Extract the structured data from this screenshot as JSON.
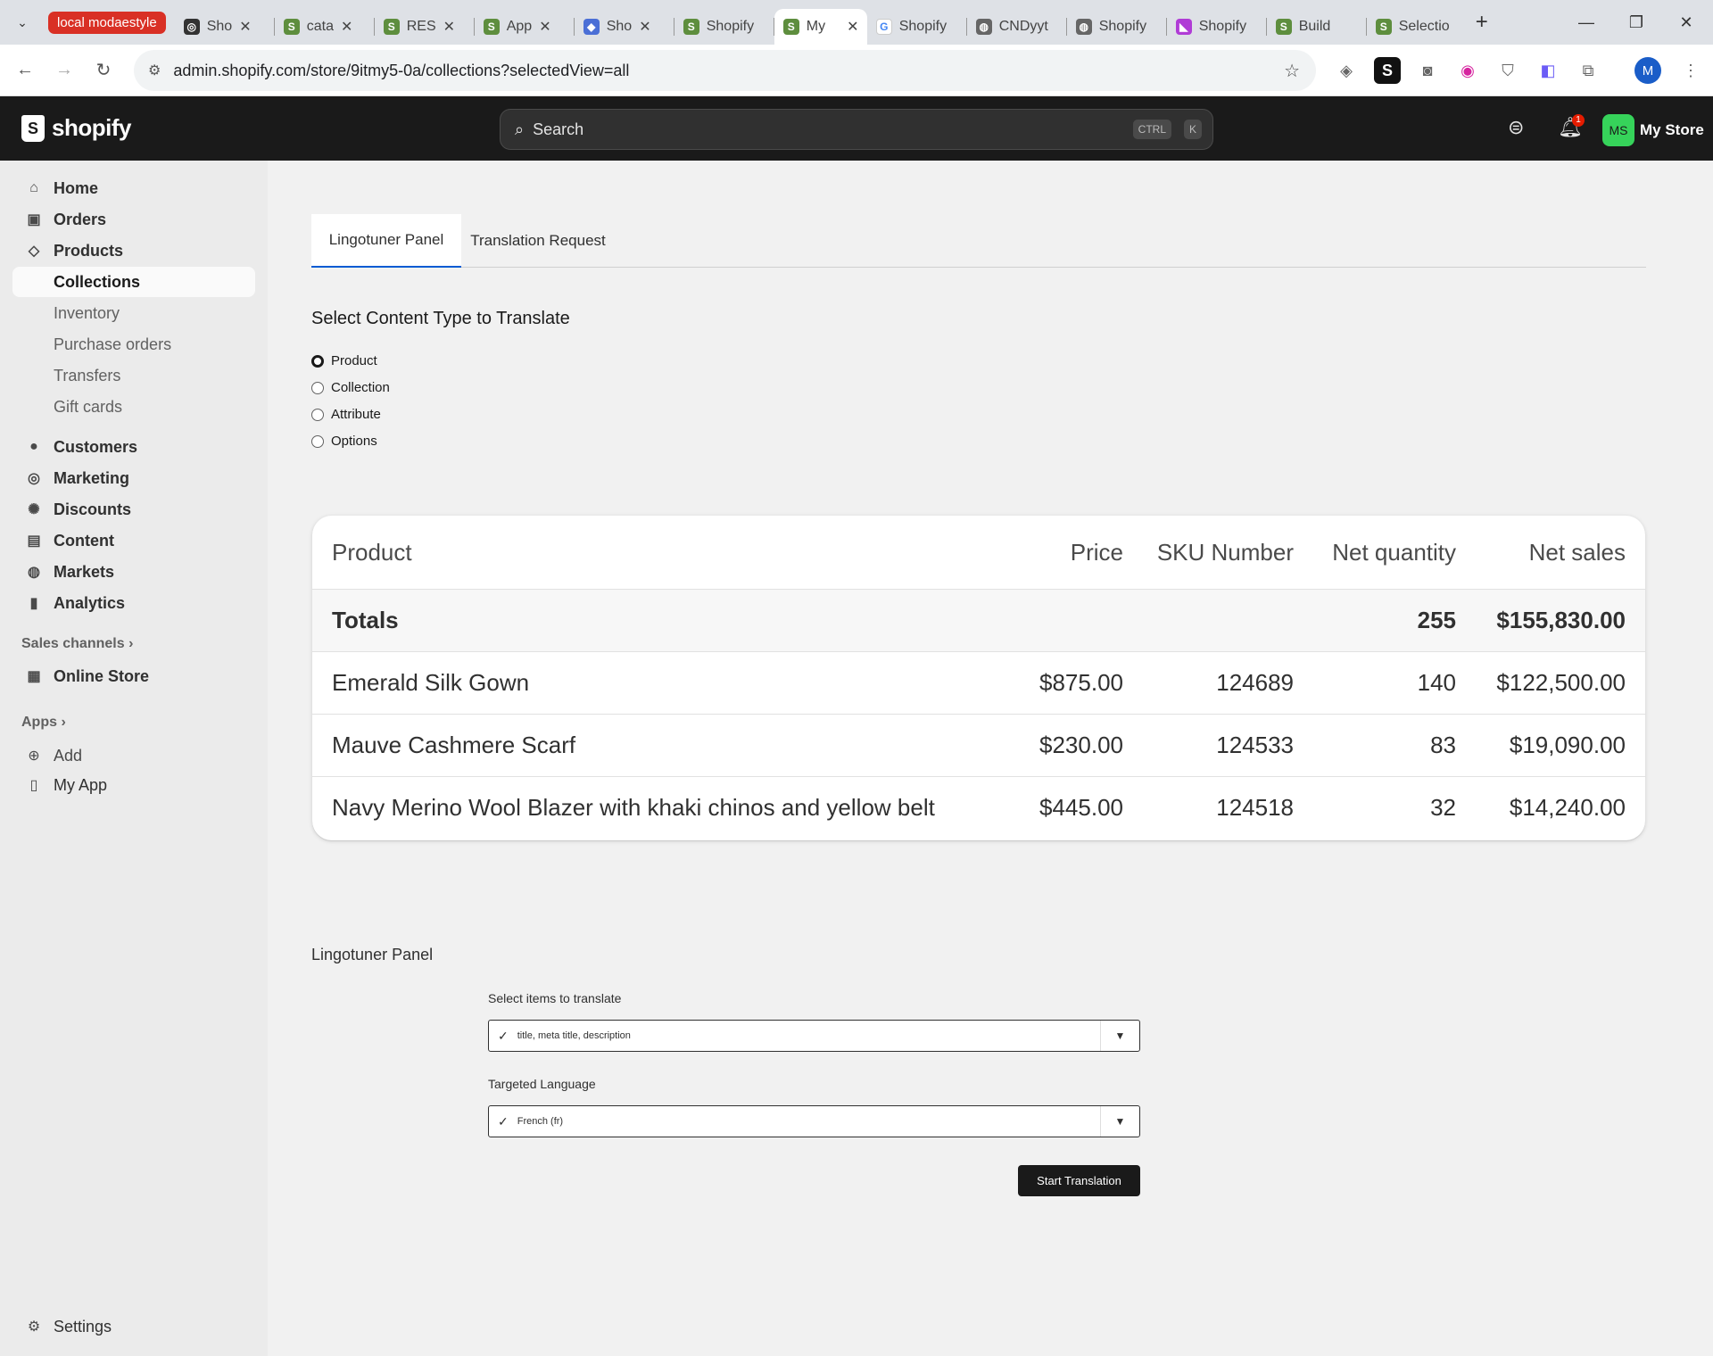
{
  "browser": {
    "group_label": "local modaestyle",
    "tabs": [
      {
        "title": "Sho",
        "active": false
      },
      {
        "title": "cata",
        "active": false
      },
      {
        "title": "RES",
        "active": false
      },
      {
        "title": "App",
        "active": false
      },
      {
        "title": "Sho",
        "active": false
      },
      {
        "title": "Shopify",
        "active": false
      },
      {
        "title": "My",
        "active": true
      },
      {
        "title": "Shopify",
        "active": false
      },
      {
        "title": "CNDyyt",
        "active": false
      },
      {
        "title": "Shopify",
        "active": false
      },
      {
        "title": "Shopify",
        "active": false
      },
      {
        "title": "Build",
        "active": false
      },
      {
        "title": "Selectio",
        "active": false
      }
    ],
    "url": "admin.shopify.com/store/9itmy5-0a/collections?selectedView=all",
    "profile_initial": "M"
  },
  "topbar": {
    "logo_text": "shopify",
    "search_placeholder": "Search",
    "shortcut_ctrl": "CTRL",
    "shortcut_k": "K",
    "notification_count": "1",
    "avatar_initials": "MS",
    "store_name": "My Store"
  },
  "sidebar": {
    "home": "Home",
    "orders": "Orders",
    "products": "Products",
    "collections": "Collections",
    "inventory": "Inventory",
    "purchase_orders": "Purchase orders",
    "transfers": "Transfers",
    "gift_cards": "Gift cards",
    "customers": "Customers",
    "marketing": "Marketing",
    "discounts": "Discounts",
    "content": "Content",
    "markets": "Markets",
    "analytics": "Analytics",
    "sales_channels": "Sales channels",
    "online_store": "Online Store",
    "apps": "Apps",
    "add": "Add",
    "my_app": "My App",
    "settings": "Settings"
  },
  "page": {
    "tabs": [
      "Lingotuner Panel",
      "Translation Request"
    ],
    "content_heading": "Select Content Type to Translate",
    "content_types": [
      "Product",
      "Collection",
      "Attribute",
      "Options"
    ],
    "selected_content_type": "Product",
    "table": {
      "headers": [
        "Product",
        "Price",
        "SKU Number",
        "Net quantity",
        "Net sales"
      ],
      "totals": {
        "label": "Totals",
        "net_quantity": "255",
        "net_sales": "$155,830.00"
      },
      "rows": [
        {
          "product": "Emerald Silk Gown",
          "price": "$875.00",
          "sku": "124689",
          "qty": "140",
          "sales": "$122,500.00"
        },
        {
          "product": "Mauve Cashmere Scarf",
          "price": "$230.00",
          "sku": "124533",
          "qty": "83",
          "sales": "$19,090.00"
        },
        {
          "product": "Navy Merino Wool Blazer with khaki chinos and yellow belt",
          "price": "$445.00",
          "sku": "124518",
          "qty": "32",
          "sales": "$14,240.00"
        }
      ]
    },
    "panel": {
      "title": "Lingotuner Panel",
      "items_label": "Select items to translate",
      "items_value": "title, meta title, description",
      "language_label": "Targeted Language",
      "language_value": "French (fr)",
      "start_button": "Start Translation"
    }
  }
}
